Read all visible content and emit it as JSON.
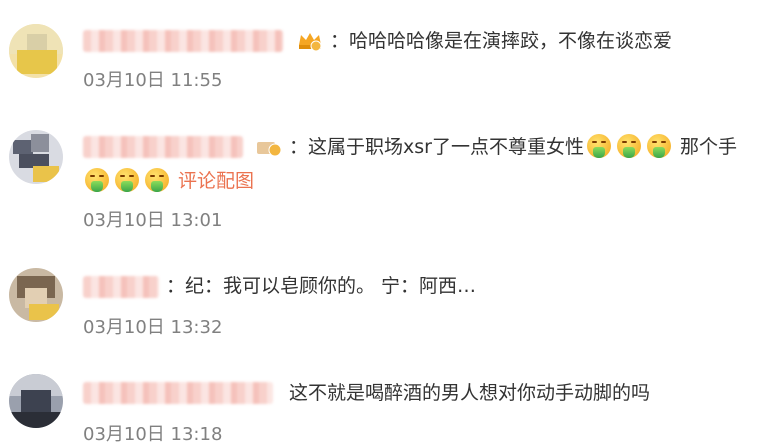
{
  "comments": [
    {
      "text": "：哈哈哈哈像是在演摔跤，不像在谈恋爱",
      "time": "03月10日 11:55",
      "has_badge": true
    },
    {
      "text_before_emoji": "：这属于职场xsr了一点不尊重女性",
      "text_after_emoji": "那个手",
      "emoji_icon": "vomit-face-emoji",
      "view_image": "评论配图",
      "time": "03月10日 13:01",
      "has_badge": true
    },
    {
      "text": "：纪：我可以皂顾你的。 宁：阿西…",
      "time": "03月10日 13:32"
    },
    {
      "text": "这不就是喝醉酒的男人想对你动手动脚的吗",
      "time": "03月10日 13:18"
    }
  ],
  "colors": {
    "time": "#808080",
    "link": "#eb7350",
    "text": "#333333"
  }
}
